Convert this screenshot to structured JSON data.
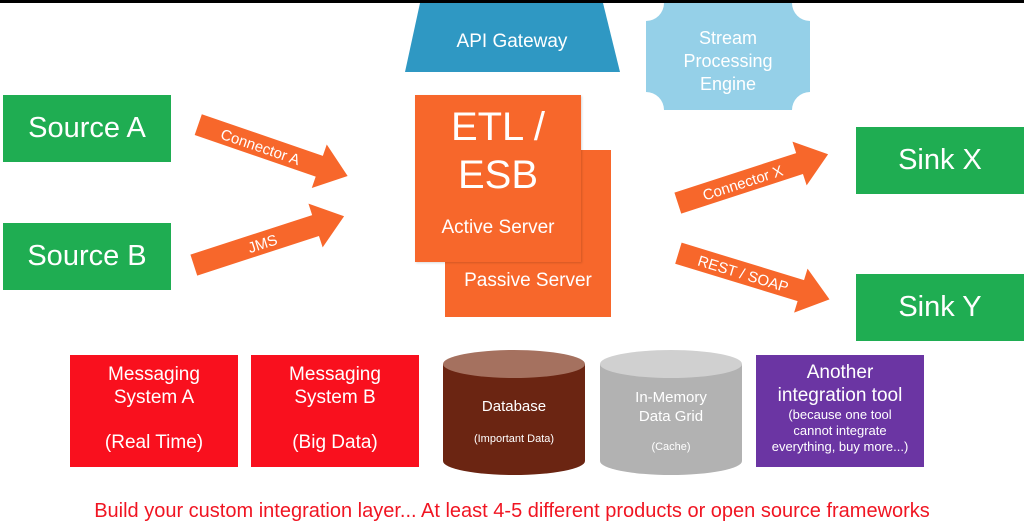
{
  "colors": {
    "source_sink": "#1fad52",
    "etl": "#f7672b",
    "arrow": "#f7672b",
    "api_gateway": "#2f98c3",
    "stream_engine": "#95d0e8",
    "messaging": "#f9101e",
    "database_body": "#6b2512",
    "database_top": "#a5715f",
    "grid_body": "#b2b2b2",
    "grid_top": "#d0d0d0",
    "purple": "#6b35a3",
    "footer_text": "#f01522"
  },
  "top": {
    "api_gateway": "API Gateway",
    "stream_engine": [
      "Stream",
      "Processing",
      "Engine"
    ]
  },
  "sources": [
    {
      "label": "Source A"
    },
    {
      "label": "Source B"
    }
  ],
  "sinks": [
    {
      "label": "Sink X"
    },
    {
      "label": "Sink Y"
    }
  ],
  "connectors": {
    "in_a": "Connector A",
    "in_b": "JMS",
    "out_x": "Connector X",
    "out_y": "REST / SOAP"
  },
  "etl": {
    "title_line1": "ETL /",
    "title_line2": "ESB",
    "active": "Active Server",
    "passive": "Passive Server"
  },
  "bottom": {
    "messaging_a": {
      "line1": "Messaging",
      "line2": "System A",
      "note": "(Real Time)"
    },
    "messaging_b": {
      "line1": "Messaging",
      "line2": "System B",
      "note": "(Big Data)"
    },
    "database": {
      "title": "Database",
      "note": "(Important Data)"
    },
    "data_grid": {
      "line1": "In-Memory",
      "line2": "Data Grid",
      "note": "(Cache)"
    },
    "another_tool": {
      "line1": "Another",
      "line2": "integration tool",
      "note1": "(because one tool",
      "note2": "cannot integrate",
      "note3": "everything, buy more...)"
    }
  },
  "footer": "Build your custom integration layer... At least 4-5 different products or open source frameworks"
}
